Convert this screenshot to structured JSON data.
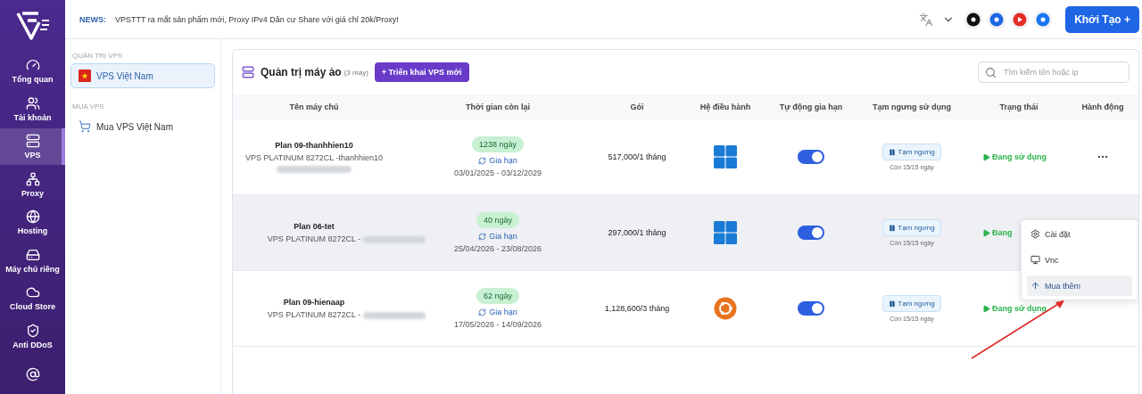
{
  "nav": [
    {
      "label": "Tổng quan",
      "selected": false
    },
    {
      "label": "Tài khoản",
      "selected": false
    },
    {
      "label": "VPS",
      "selected": true
    },
    {
      "label": "Proxy",
      "selected": false
    },
    {
      "label": "Hosting",
      "selected": false
    },
    {
      "label": "Máy chủ riêng",
      "selected": false
    },
    {
      "label": "Cloud Store",
      "selected": false
    },
    {
      "label": "Anti DDoS",
      "selected": false
    },
    {
      "selected": false
    }
  ],
  "news": {
    "label": "NEWS:",
    "text": "VPSTTT ra mắt sản phẩm mới, Proxy IPv4 Dân cư Share với giá chỉ 20k/Proxy!"
  },
  "header": {
    "create_button": "Khởi Tạo +"
  },
  "sidebar": {
    "sections": [
      {
        "title": "QUẢN TRỊ VPS",
        "items": [
          {
            "label": "VPS Việt Nam",
            "selected": true
          }
        ]
      },
      {
        "title": "MUA VPS",
        "items": [
          {
            "label": "Mua VPS Việt Nam",
            "selected": false
          }
        ]
      }
    ]
  },
  "panel": {
    "title": "Quản trị máy ảo",
    "count": "(3 máy)",
    "deploy_button": "+ Triển khai VPS mới",
    "search": {
      "placeholder": "Tìm kiếm tên hoặc ip"
    }
  },
  "table": {
    "columns": [
      "Tên máy chủ",
      "Thời gian còn lại",
      "Gói",
      "Hệ điều hành",
      "Tự động gia hạn",
      "Tạm ngưng sử dụng",
      "Trạng thái",
      "Hành động"
    ],
    "rows": [
      {
        "name": "Plan 09-thanhhien10",
        "plan": "VPS PLATINUM 8272CL -thanhhien10",
        "plan_redacted": false,
        "extra_line_redacted": true,
        "days": "1238 ngày",
        "renew": "Gia hạn",
        "period": "03/01/2025 - 03/12/2029",
        "price": "517,000/1 tháng",
        "kind": "windows",
        "auto_renew": true,
        "suspend_button": "Tạm ngưng",
        "suspend_note": "Còn 15/15 ngày",
        "status": "Đang sử dụng",
        "show_more": true,
        "selected": false
      },
      {
        "name": "Plan 06-tet",
        "plan": "VPS PLATINUM 8272CL -",
        "plan_redacted": true,
        "extra_line_redacted": false,
        "days": "40 ngày",
        "renew": "Gia hạn",
        "period": "25/04/2026 - 23/08/2026",
        "price": "297,000/1 tháng",
        "kind": "windows",
        "auto_renew": true,
        "suspend_button": "Tạm ngưng",
        "suspend_note": "Còn 15/15 ngày",
        "status": "Đang",
        "selected": true
      },
      {
        "name": "Plan 09-hienaap",
        "plan": "VPS PLATINUM 8272CL -",
        "plan_redacted": true,
        "extra_line_redacted": false,
        "days": "62 ngày",
        "renew": "Gia hạn",
        "period": "17/05/2026 - 14/09/2026",
        "price": "1,128,600/3 tháng",
        "kind": "ubuntu",
        "auto_renew": true,
        "suspend_button": "Tạm ngưng",
        "suspend_note": "Còn 15/15 ngày",
        "status": "Đang sử dụng",
        "selected": false
      }
    ]
  },
  "menu": {
    "items": [
      {
        "label": "Cài đặt",
        "selected": false
      },
      {
        "label": "Vnc",
        "selected": false
      },
      {
        "label": "Mua thêm",
        "selected": true
      }
    ]
  },
  "annotation": {
    "arrow": true
  }
}
